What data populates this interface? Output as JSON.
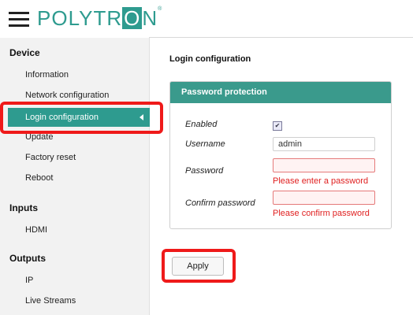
{
  "brand": {
    "logo_pre": "POLYTR",
    "logo_boxed": "O",
    "logo_post": "N",
    "logo_reg": "®",
    "accent_color": "#2e9b8f",
    "error_color": "#e02020",
    "highlight_color": "#ef1a1a"
  },
  "sidebar": {
    "sections": [
      {
        "title": "Device",
        "items": [
          "Information",
          "Network configuration",
          "Login configuration",
          "Update",
          "Factory reset",
          "Reboot"
        ]
      },
      {
        "title": "Inputs",
        "items": [
          "HDMI"
        ]
      },
      {
        "title": "Outputs",
        "items": [
          "IP",
          "Live Streams"
        ]
      }
    ],
    "active_item": "Login configuration"
  },
  "main": {
    "title": "Login configuration",
    "panel": {
      "header": "Password protection",
      "enabled_label": "Enabled",
      "enabled_checked": true,
      "username_label": "Username",
      "username_value": "admin",
      "password_label": "Password",
      "password_error": "Please enter a password",
      "confirm_label": "Confirm password",
      "confirm_error": "Please confirm password"
    },
    "apply_label": "Apply"
  }
}
